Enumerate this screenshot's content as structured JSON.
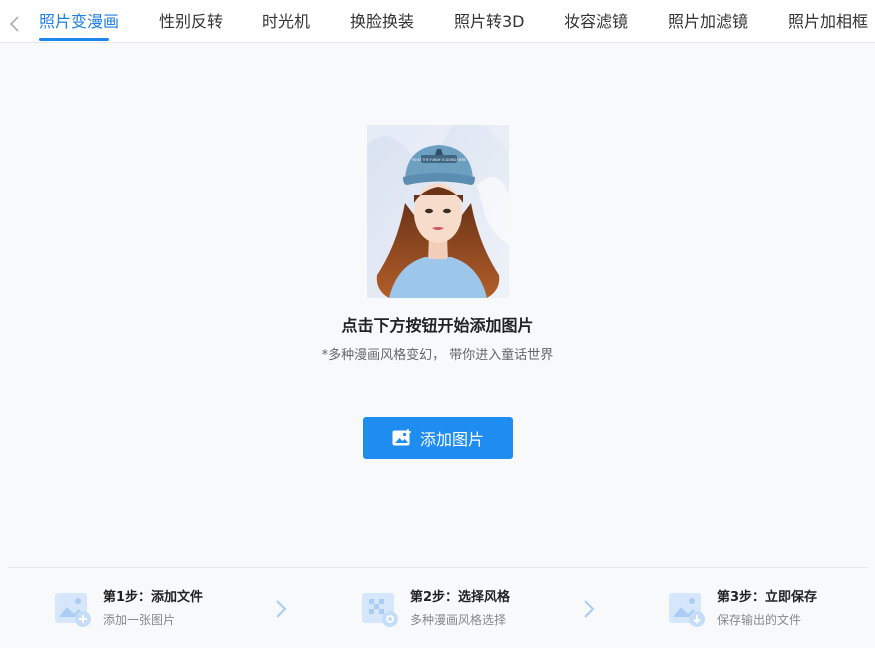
{
  "tabs": [
    {
      "label": "照片变漫画",
      "active": true
    },
    {
      "label": "性别反转"
    },
    {
      "label": "时光机"
    },
    {
      "label": "换脸换装"
    },
    {
      "label": "照片转3D"
    },
    {
      "label": "妆容滤镜"
    },
    {
      "label": "照片加滤镜"
    },
    {
      "label": "照片加相框"
    }
  ],
  "hero": {
    "title": "点击下方按钮开始添加图片",
    "subtitle": "*多种漫画风格变幻， 带你进入童话世界",
    "button_label": "添加图片",
    "button_icon": "image-add-icon",
    "image_cap_text": "WHAT THE FUNNY IS DOING HERE"
  },
  "steps": [
    {
      "title": "第1步：添加文件",
      "desc": "添加一张图片",
      "icon": "image-add-icon"
    },
    {
      "title": "第2步：选择风格",
      "desc": "多种漫画风格选择",
      "icon": "style-select-icon"
    },
    {
      "title": "第3步：立即保存",
      "desc": "保存输出的文件",
      "icon": "image-download-icon"
    }
  ],
  "colors": {
    "accent": "#1f8cf2",
    "active_tab": "#1f7ee0",
    "background": "#f8f9fb"
  }
}
